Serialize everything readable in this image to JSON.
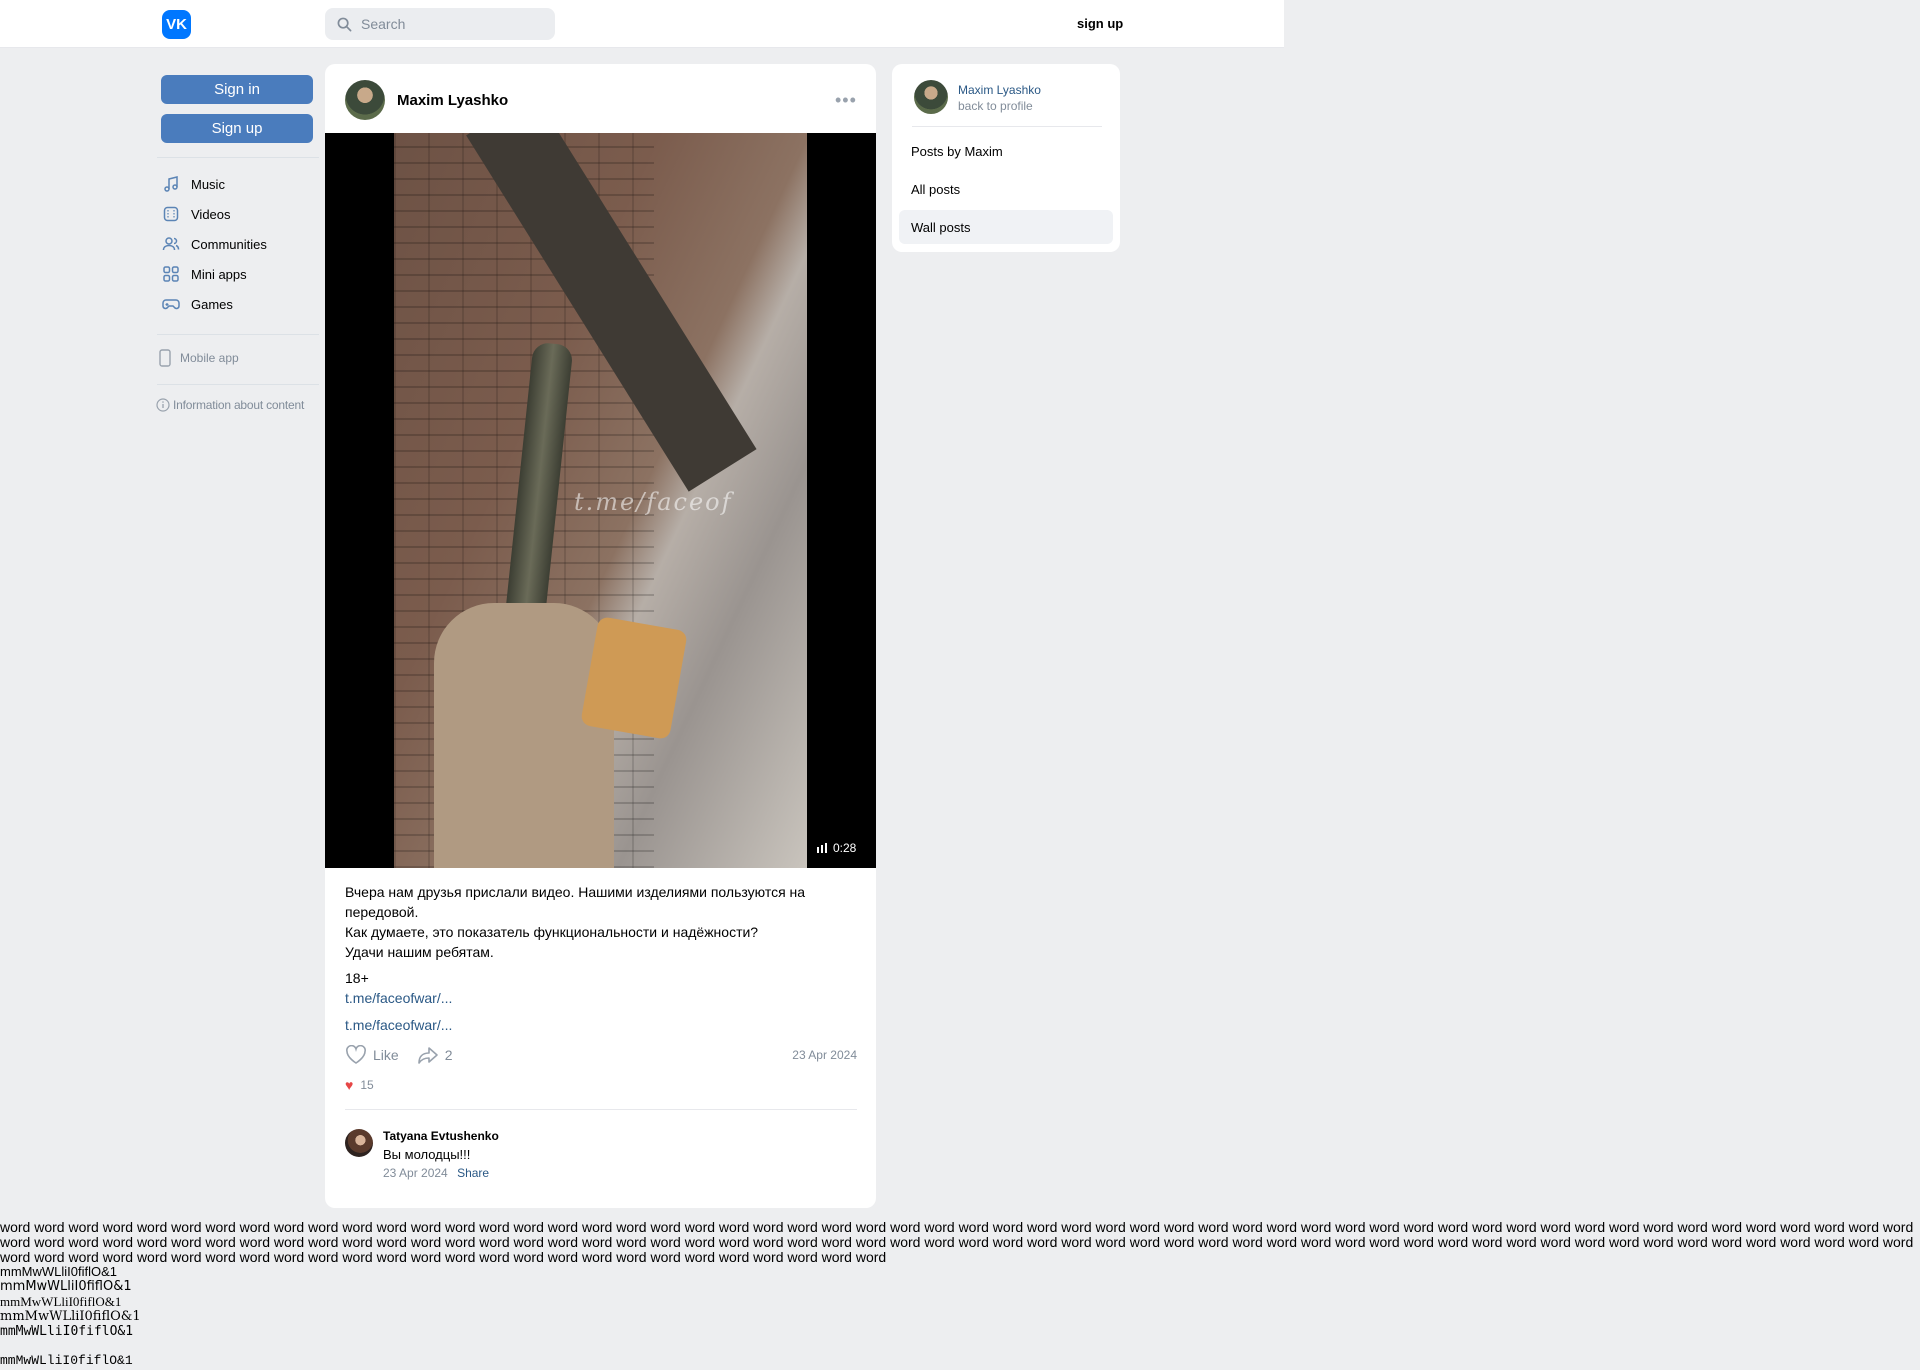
{
  "header": {
    "logo_text": "VK",
    "search_placeholder": "Search",
    "signup_label": "sign up"
  },
  "left_nav": {
    "sign_in_label": "Sign in",
    "sign_up_label": "Sign up",
    "items": [
      {
        "label": "Music",
        "icon": "music-icon"
      },
      {
        "label": "Videos",
        "icon": "videos-icon"
      },
      {
        "label": "Communities",
        "icon": "communities-icon"
      },
      {
        "label": "Mini apps",
        "icon": "mini-apps-icon"
      },
      {
        "label": "Games",
        "icon": "games-icon"
      }
    ],
    "mobile_app_label": "Mobile app",
    "info_label": "Information about content"
  },
  "post": {
    "author": "Maxim Lyashko",
    "video": {
      "watermark": "t.me/faceof",
      "duration": "0:28"
    },
    "text_lines": [
      "Вчера нам друзья прислали видео. Нашими изделиями пользуются на передовой.",
      "Как думаете, это показатель функциональности и надёжности?",
      "Удачи нашим ребятам."
    ],
    "age_label": "18+",
    "link_1": "t.me/faceofwar/...",
    "link_2": "t.me/faceofwar/...",
    "like_label": "Like",
    "share_count": "2",
    "date": "23 Apr 2024",
    "reactions_count": "15",
    "comment": {
      "author": "Tatyana Evtushenko",
      "text": "Вы молодцы!!!",
      "date": "23 Apr 2024",
      "share_label": "Share"
    }
  },
  "sidebar": {
    "profile_name": "Maxim Lyashko",
    "back_label": "back to profile",
    "items": [
      {
        "label": "Posts by Maxim",
        "active": false
      },
      {
        "label": "All posts",
        "active": false
      },
      {
        "label": "Wall posts",
        "active": true
      }
    ]
  },
  "test_text": {
    "words": "word word word word word word word word word word word word word word word word word word word word word word word word word word word word word word word word word word word word word word word word word word word word word word word word word word word word word word word word word word word word word word word word word word word word word word word word word word word word word word word word word word word word word word word word word word word word word word word word word word word word word word word word word word word word word word word word word word word word word word word word word word word word word word word word word word word word word word word word word word",
    "lines": [
      "mmMwWLliI0fiflO&1",
      "mmMwWLliI0fiflO&1",
      "mmMwWLliI0fiflO&1",
      "mmMwWLliI0fiflO&1",
      "mmMwWLliI0fiflO&1",
      "mmMwWLliI0fiflO&1"
    ]
  }
}
